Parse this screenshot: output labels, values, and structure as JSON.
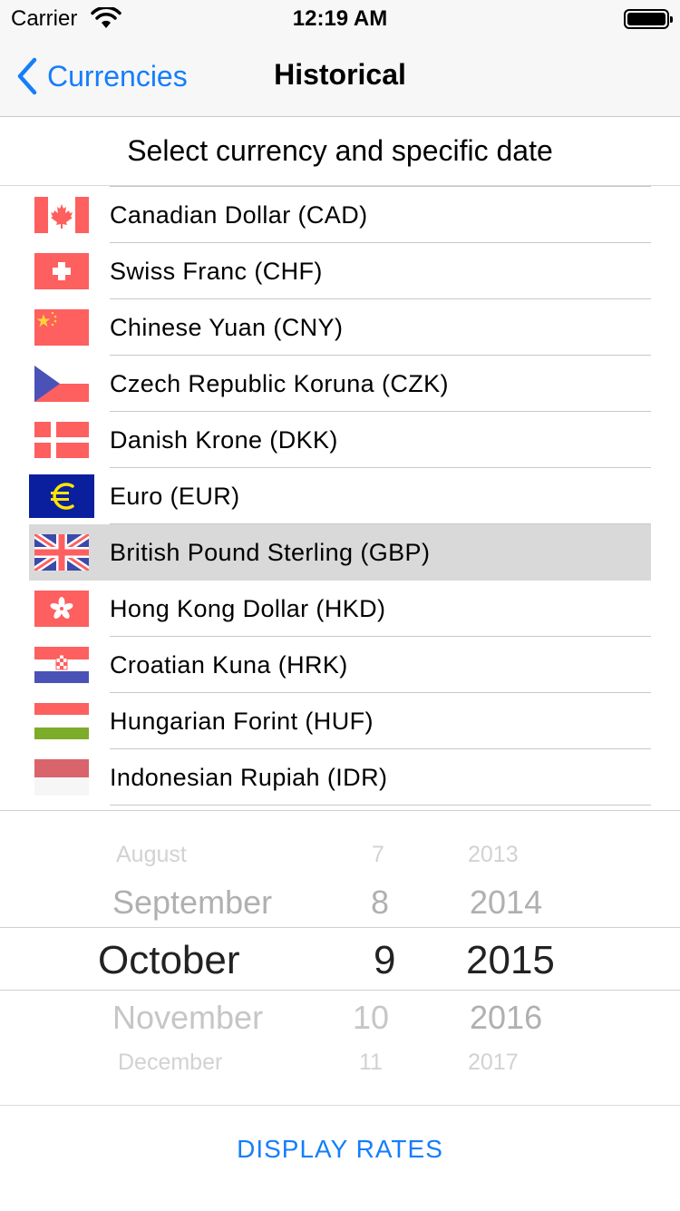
{
  "status_bar": {
    "carrier": "Carrier",
    "time": "12:19 AM"
  },
  "nav": {
    "back_label": "Currencies",
    "title": "Historical"
  },
  "header": {
    "text": "Select currency and specific date"
  },
  "currencies": [
    {
      "name": "Canadian Dollar (CAD)",
      "flag": "canada-flag-icon",
      "selected": false
    },
    {
      "name": "Swiss Franc (CHF)",
      "flag": "switzerland-flag-icon",
      "selected": false
    },
    {
      "name": "Chinese Yuan (CNY)",
      "flag": "china-flag-icon",
      "selected": false
    },
    {
      "name": "Czech Republic Koruna (CZK)",
      "flag": "czech-flag-icon",
      "selected": false
    },
    {
      "name": "Danish Krone (DKK)",
      "flag": "denmark-flag-icon",
      "selected": false
    },
    {
      "name": "Euro (EUR)",
      "flag": "euro-flag-icon",
      "selected": false
    },
    {
      "name": "British Pound Sterling (GBP)",
      "flag": "uk-flag-icon",
      "selected": true
    },
    {
      "name": "Hong Kong Dollar (HKD)",
      "flag": "hong-kong-flag-icon",
      "selected": false
    },
    {
      "name": "Croatian Kuna (HRK)",
      "flag": "croatia-flag-icon",
      "selected": false
    },
    {
      "name": "Hungarian Forint (HUF)",
      "flag": "hungary-flag-icon",
      "selected": false
    },
    {
      "name": "Indonesian Rupiah (IDR)",
      "flag": "indonesia-flag-icon",
      "selected": false
    }
  ],
  "picker": {
    "months": [
      "August",
      "September",
      "October",
      "November",
      "December"
    ],
    "days": [
      "7",
      "8",
      "9",
      "10",
      "11"
    ],
    "years": [
      "2013",
      "2014",
      "2015",
      "2016",
      "2017"
    ],
    "selected": {
      "month": "October",
      "day": "9",
      "year": "2015"
    }
  },
  "action": {
    "label": "DISPLAY RATES"
  },
  "colors": {
    "accent": "#157efb",
    "selected_row": "#d9d9d9",
    "flag_red": "#fe5f5f"
  }
}
